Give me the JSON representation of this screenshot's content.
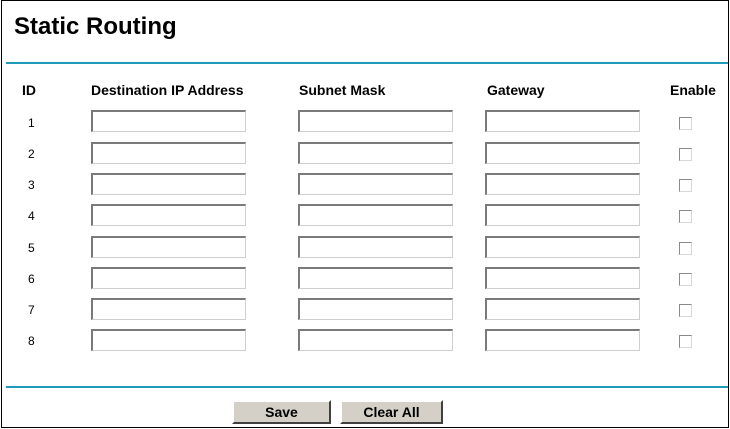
{
  "page": {
    "title": "Static Routing"
  },
  "columns": {
    "id": "ID",
    "destination": "Destination IP Address",
    "subnet": "Subnet Mask",
    "gateway": "Gateway",
    "enable": "Enable"
  },
  "rows": [
    {
      "id": "1",
      "destination": "",
      "subnet": "",
      "gateway": "",
      "enabled": false
    },
    {
      "id": "2",
      "destination": "",
      "subnet": "",
      "gateway": "",
      "enabled": false
    },
    {
      "id": "3",
      "destination": "",
      "subnet": "",
      "gateway": "",
      "enabled": false
    },
    {
      "id": "4",
      "destination": "",
      "subnet": "",
      "gateway": "",
      "enabled": false
    },
    {
      "id": "5",
      "destination": "",
      "subnet": "",
      "gateway": "",
      "enabled": false
    },
    {
      "id": "6",
      "destination": "",
      "subnet": "",
      "gateway": "",
      "enabled": false
    },
    {
      "id": "7",
      "destination": "",
      "subnet": "",
      "gateway": "",
      "enabled": false
    },
    {
      "id": "8",
      "destination": "",
      "subnet": "",
      "gateway": "",
      "enabled": false
    }
  ],
  "buttons": {
    "save": "Save",
    "clear_all": "Clear All"
  },
  "colors": {
    "accent_rule": "#1e9bb8",
    "button_face": "#d4d0c8"
  }
}
